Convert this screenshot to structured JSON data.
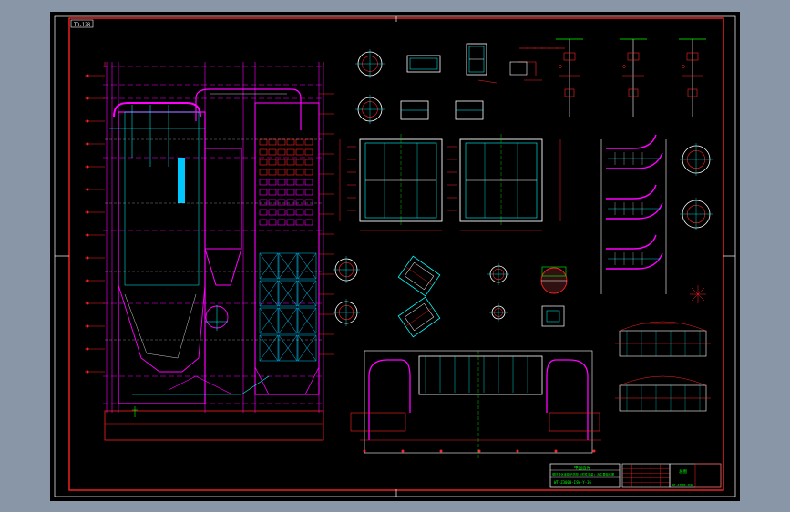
{
  "colors": {
    "background": "#8996a8",
    "paper": "#000000",
    "frame": "#ff0000",
    "magenta": "#ff00ff",
    "white": "#ffffff",
    "cyan": "#00ffff",
    "green": "#00ff00",
    "yellow": "#ffff00"
  },
  "drawing": {
    "corner_tag": "TD-128",
    "title_block": {
      "title": "中国首先",
      "sub1": "循环流化床锅炉总图 (附件清单) 及主要部件图",
      "sub2": "WT-Z3000-ISW-Y-36",
      "right_label": "总图",
      "small": "WT-Z3000-ISW"
    }
  }
}
